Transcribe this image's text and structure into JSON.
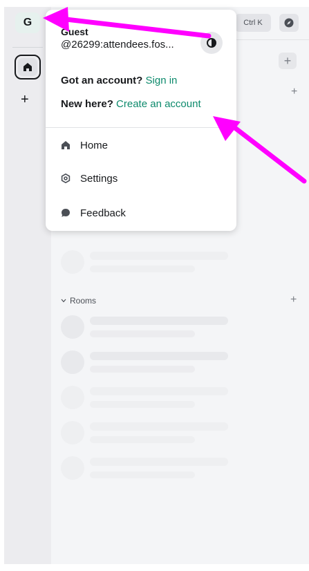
{
  "spaces": {
    "avatar_letter": "G",
    "add_label": "+"
  },
  "header": {
    "search_shortcut": "Ctrl K",
    "add_label": "+"
  },
  "roomlist": {
    "section_add": "+",
    "rooms_label": "Rooms",
    "rooms_add": "+"
  },
  "menu": {
    "user_name": "Guest",
    "user_id": "@26299:attendees.fos...",
    "account_prompt": "Got an account?",
    "sign_in": "Sign in",
    "new_prompt": "New here?",
    "create_account": "Create an account",
    "items": [
      {
        "label": "Home",
        "icon": "home-icon"
      },
      {
        "label": "Settings",
        "icon": "settings-icon"
      },
      {
        "label": "Feedback",
        "icon": "feedback-icon"
      }
    ]
  },
  "colors": {
    "accent": "#0d8a6c",
    "annotation": "#ff00ff",
    "background": "#f4f5f7"
  }
}
